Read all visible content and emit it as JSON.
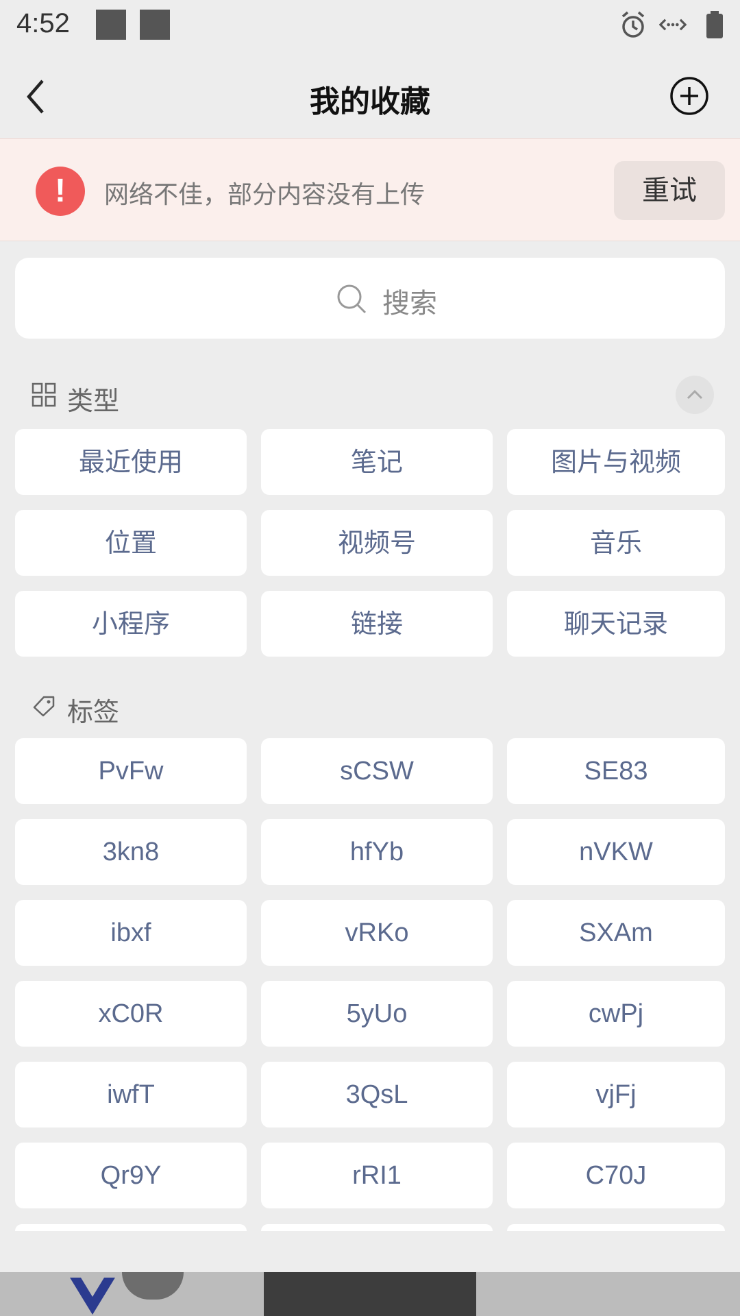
{
  "status_bar": {
    "time": "4:52",
    "icons": [
      "alarm-icon",
      "data-sync-icon",
      "battery-icon"
    ]
  },
  "nav": {
    "title": "我的收藏",
    "back_icon": "chevron-left-icon",
    "add_icon": "plus-circle-icon"
  },
  "banner": {
    "icon": "exclamation-icon",
    "icon_glyph": "!",
    "message": "网络不佳，部分内容没有上传",
    "retry_label": "重试",
    "icon_color": "#f05a5a"
  },
  "search": {
    "placeholder": "搜索"
  },
  "types_section": {
    "label": "类型",
    "items": [
      "最近使用",
      "笔记",
      "图片与视频",
      "位置",
      "视频号",
      "音乐",
      "小程序",
      "链接",
      "聊天记录"
    ]
  },
  "tags_section": {
    "label": "标签",
    "items": [
      "PvFw",
      "sCSW",
      "SE83",
      "3kn8",
      "hfYb",
      "nVKW",
      "ibxf",
      "vRKo",
      "SXAm",
      "xC0R",
      "5yUo",
      "cwPj",
      "iwfT",
      "3QsL",
      "vjFj",
      "Qr9Y",
      "rRI1",
      "C70J"
    ]
  },
  "colors": {
    "accent_text": "#5b6a8e",
    "banner_bg": "#fbefec"
  }
}
